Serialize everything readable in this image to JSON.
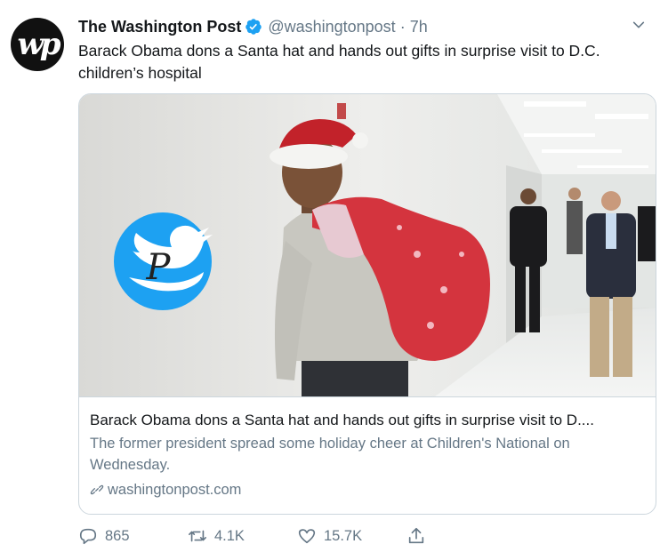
{
  "tweet": {
    "avatar_text": "wp",
    "author_name": "The Washington Post",
    "handle": "@washingtonpost",
    "separator": "·",
    "time": "7h",
    "text": "Barack Obama dons a Santa hat and hands out gifts in surprise visit to D.C. children’s hospital"
  },
  "card": {
    "title": "Barack Obama dons a Santa hat and hands out gifts in surprise visit to D....",
    "description": "The former president spread some holiday cheer at Children's National on Wednesday.",
    "domain": "washingtonpost.com",
    "watermark_letter": "P"
  },
  "actions": {
    "replies": "865",
    "retweets": "4.1K",
    "likes": "15.7K"
  },
  "colors": {
    "verified": "#1da1f2",
    "muted": "#657786",
    "border": "#ccd6dd",
    "twitter_blue": "#1da1f2"
  },
  "icons": [
    "verified-badge-icon",
    "chevron-down-icon",
    "link-icon",
    "reply-icon",
    "retweet-icon",
    "like-icon",
    "share-icon",
    "twitter-bird-icon"
  ]
}
